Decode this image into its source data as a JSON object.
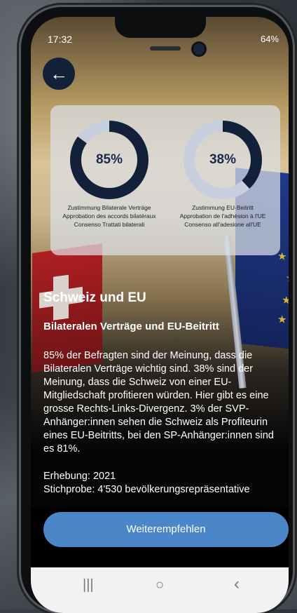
{
  "status_bar": {
    "time": "17:32",
    "battery": "64%"
  },
  "back_button": {
    "icon": "arrow-left-icon",
    "glyph": "←"
  },
  "stats": [
    {
      "percent": 85,
      "label_text": "85%",
      "caption": [
        "Zustimmung Bilaterale Verträge",
        "Approbation des accords bilatéraux",
        "Consenso Trattati bilaterali"
      ]
    },
    {
      "percent": 38,
      "label_text": "38%",
      "caption": [
        "Zustimmung EU-Beitritt",
        "Approbation de l'adhésion à l'UE",
        "Consenso all'adesione all'UE"
      ]
    }
  ],
  "colors": {
    "donut_fill": "#13203a",
    "donut_track": "#c7cfdc",
    "cta": "#4a86c8"
  },
  "article": {
    "title": "Schweiz und EU",
    "subtitle": "Bilateralen Verträge und EU-Beitritt",
    "body": "85% der Befragten sind der Meinung, dass die Bilateralen Verträge wichtig sind. 38% sind der Meinung, dass die Schweiz von einer EU-Mitgliedschaft profitieren würden. Hier gibt es eine grosse Rechts-Links-Divergenz. 3% der SVP-Anhänger:innen sehen die Schweiz als Profiteurin eines EU-Beitritts, bei den SP-Anhänger:innen sind es 81%.",
    "survey": "Erhebung: 2021",
    "sample": "Stichprobe: 4'530 bevölkerungsrepräsentative"
  },
  "cta_label": "Weiterempfehlen",
  "nav": {
    "recent": "|||",
    "home": "○",
    "back": "‹"
  }
}
